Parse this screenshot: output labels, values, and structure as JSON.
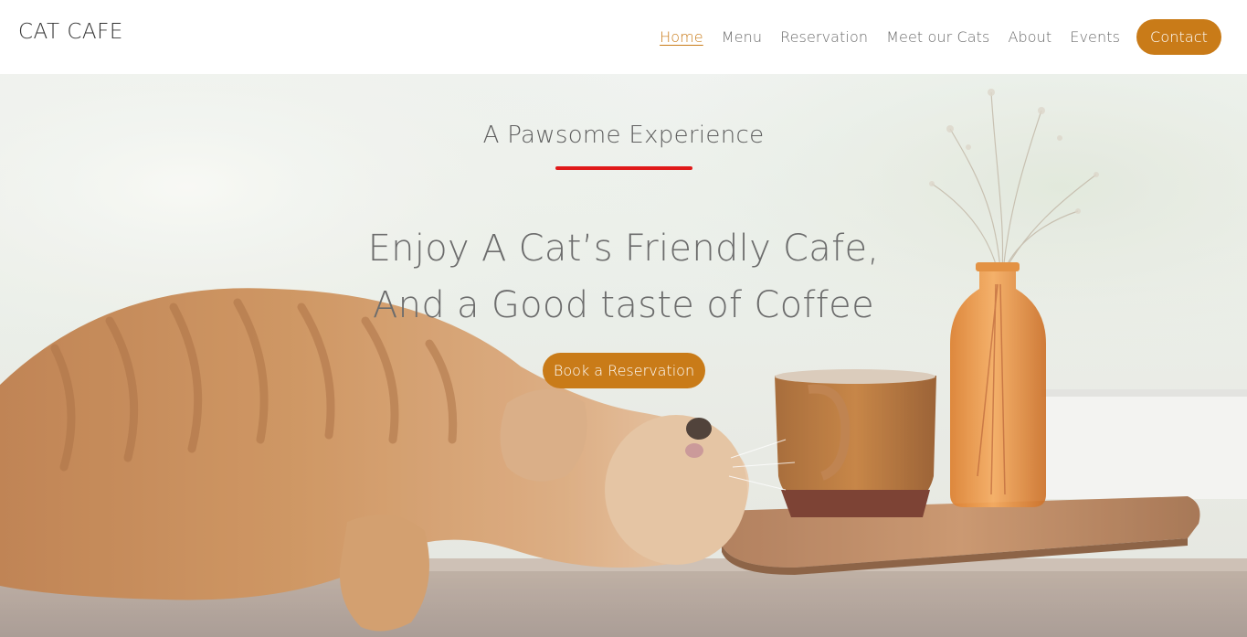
{
  "brand": "CAT CAFE",
  "nav": {
    "items": [
      "Home",
      "Menu",
      "Reservation",
      "Meet our Cats",
      "About",
      "Events"
    ],
    "active": "Home",
    "contact_label": "Contact"
  },
  "hero": {
    "subtitle": "A Pawsome Experience",
    "headline_line1": "Enjoy A Cat’s Friendly Cafe,",
    "headline_line2": "And a Good taste of Coffee",
    "cta_label": "Book a Reservation"
  },
  "colors": {
    "accent": "#c97b18",
    "underline": "#e01a1a",
    "text": "#6c6c6c"
  }
}
